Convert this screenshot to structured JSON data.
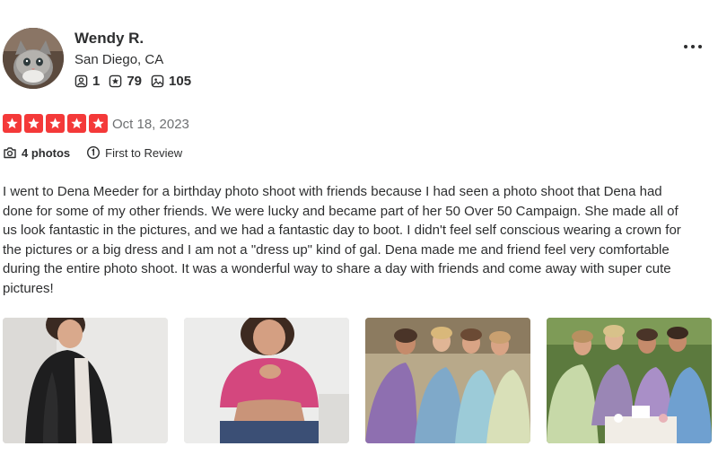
{
  "user": {
    "name": "Wendy R.",
    "location": "San Diego, CA",
    "stats": {
      "friends": "1",
      "reviews": "79",
      "photos": "105"
    },
    "avatar_icon": "cat-photo"
  },
  "review": {
    "rating": 5,
    "max_rating": 5,
    "date": "Oct 18, 2023",
    "photos_badge": "4 photos",
    "first_badge": "First to Review",
    "text": "I went to Dena Meeder for a birthday photo shoot with friends because I had seen a photo shoot that Dena had done for some of my other friends. We were lucky and became part of her 50 Over 50 Campaign. She made all of us look fantastic in the pictures, and we had a fantastic day to boot. I didn't feel self conscious wearing a crown for the pictures or a big dress and I am not a \"dress up\" kind of gal. Dena made me and friend feel very comfortable during the entire photo shoot. It was a wonderful way to share a day with friends and come away with super cute pictures!"
  },
  "colors": {
    "star": "#f43939",
    "text": "#2d2e2f",
    "muted": "#6e7072"
  },
  "icons": {
    "more": "more-horizontal-icon",
    "friends": "friends-icon",
    "reviews": "review-star-icon",
    "photos": "photo-icon",
    "camera": "camera-icon",
    "first": "first-to-review-icon"
  }
}
